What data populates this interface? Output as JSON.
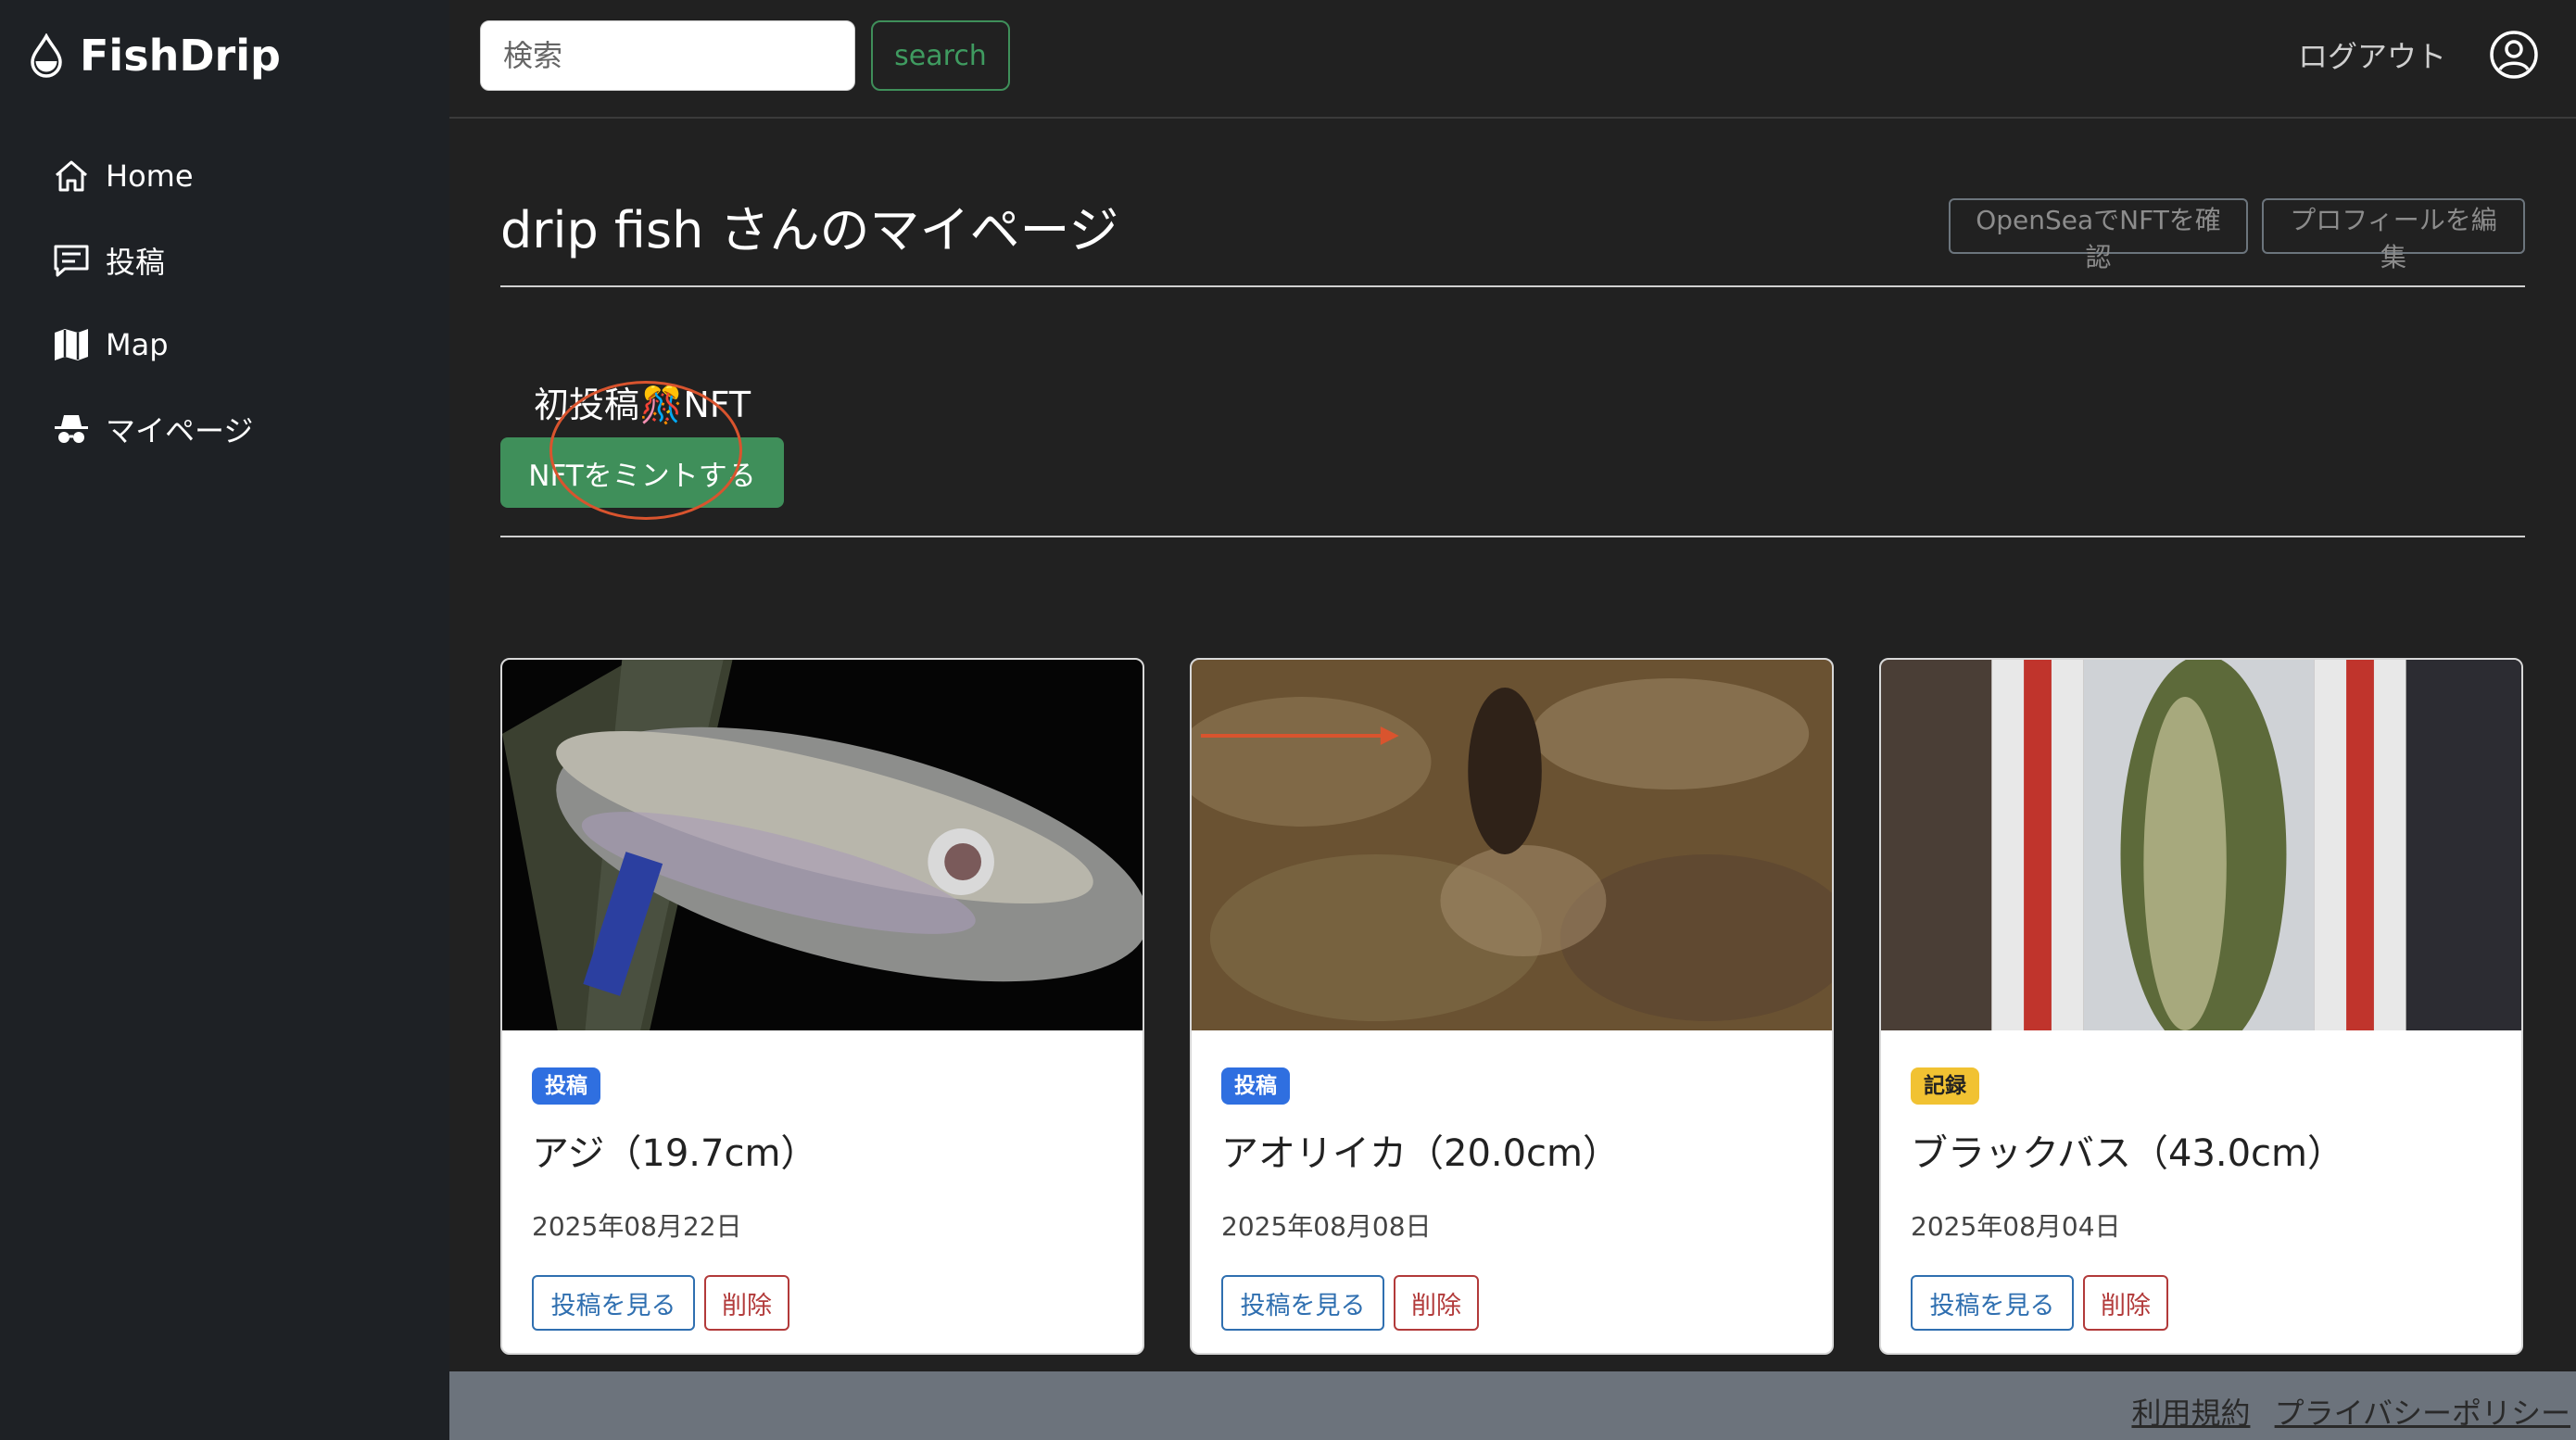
{
  "brand": {
    "name": "FishDrip"
  },
  "sidebar": {
    "items": [
      {
        "label": "Home",
        "icon": "home-icon"
      },
      {
        "label": "投稿",
        "icon": "chat-icon"
      },
      {
        "label": "Map",
        "icon": "map-icon"
      },
      {
        "label": "マイページ",
        "icon": "incognito-icon"
      }
    ]
  },
  "topbar": {
    "search_placeholder": "検索",
    "search_label": "search",
    "logout_label": "ログアウト"
  },
  "page": {
    "title": "drip fish さんのマイページ",
    "opensea_label": "OpenSeaでNFTを確認",
    "profile_label": "プロフィールを編集",
    "nft_heading": "初投稿🎊NFT",
    "mint_label": "NFTをミントする"
  },
  "cards": [
    {
      "badge": "投稿",
      "title": "アジ（19.7cm）",
      "date": "2025年08月22日",
      "view_label": "投稿を見る",
      "delete_label": "削除"
    },
    {
      "badge": "投稿",
      "title": "アオリイカ（20.0cm）",
      "date": "2025年08月08日",
      "view_label": "投稿を見る",
      "delete_label": "削除"
    },
    {
      "badge": "記録",
      "title": "ブラックバス（43.0cm）",
      "date": "2025年08月04日",
      "view_label": "投稿を見る",
      "delete_label": "削除"
    }
  ],
  "footer": {
    "terms_label": "利用規約",
    "privacy_label": "プライバシーポリシー"
  },
  "colors": {
    "success": "#3f8f5a",
    "primary": "#2f6fe0",
    "warning": "#f1c232",
    "danger": "#b23a3a",
    "annotation": "#d9542e"
  }
}
